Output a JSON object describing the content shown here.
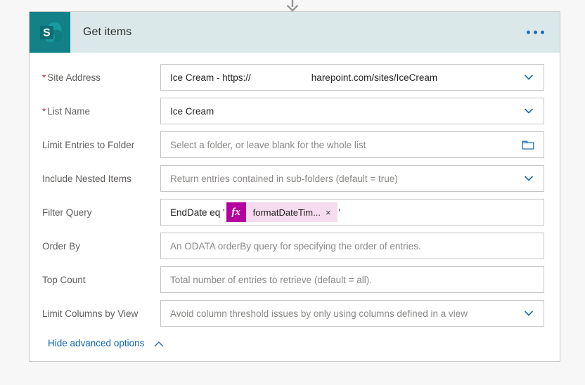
{
  "connector": {
    "icon": "arrow-down-icon"
  },
  "card": {
    "app_icon": "sharepoint-icon",
    "title": "Get items",
    "overflow_menu": "ellipsis-icon",
    "header_bg": "#dbe8ea",
    "icon_bg": "#128188",
    "accent_blue": "#0a65b8",
    "required_color": "#c4314b",
    "token_color": "#b4009e",
    "token_bg": "#f6dcef"
  },
  "fields": [
    {
      "label": "Site Address",
      "required": true,
      "value_prefix": "Ice Cream - https://",
      "value_suffix": "harepoint.com/sites/IceCream",
      "redacted": true,
      "control": "dropdown",
      "icon": "chevron-down-icon",
      "is_placeholder": false
    },
    {
      "label": "List Name",
      "required": true,
      "value": "Ice Cream",
      "control": "dropdown",
      "icon": "chevron-down-icon",
      "is_placeholder": false
    },
    {
      "label": "Limit Entries to Folder",
      "required": false,
      "value": "Select a folder, or leave blank for the whole list",
      "control": "folder-picker",
      "icon": "folder-icon",
      "is_placeholder": true
    },
    {
      "label": "Include Nested Items",
      "required": false,
      "value": "Return entries contained in sub-folders (default = true)",
      "control": "dropdown",
      "icon": "chevron-down-icon",
      "is_placeholder": true
    },
    {
      "label": "Filter Query",
      "required": false,
      "control": "expression",
      "text_before": "EndDate eq '",
      "text_after": "'",
      "token": {
        "fx": "fx",
        "label": "formatDateTim...",
        "remove": "×"
      }
    },
    {
      "label": "Order By",
      "required": false,
      "value": "An ODATA orderBy query for specifying the order of entries.",
      "control": "text",
      "icon": null,
      "is_placeholder": true
    },
    {
      "label": "Top Count",
      "required": false,
      "value": "Total number of entries to retrieve (default = all).",
      "control": "text",
      "icon": null,
      "is_placeholder": true
    },
    {
      "label": "Limit Columns by View",
      "required": false,
      "value": "Avoid column threshold issues by only using columns defined in a view",
      "control": "dropdown",
      "icon": "chevron-down-icon",
      "is_placeholder": true
    }
  ],
  "advanced": {
    "label": "Hide advanced options",
    "icon": "chevron-up-icon"
  }
}
